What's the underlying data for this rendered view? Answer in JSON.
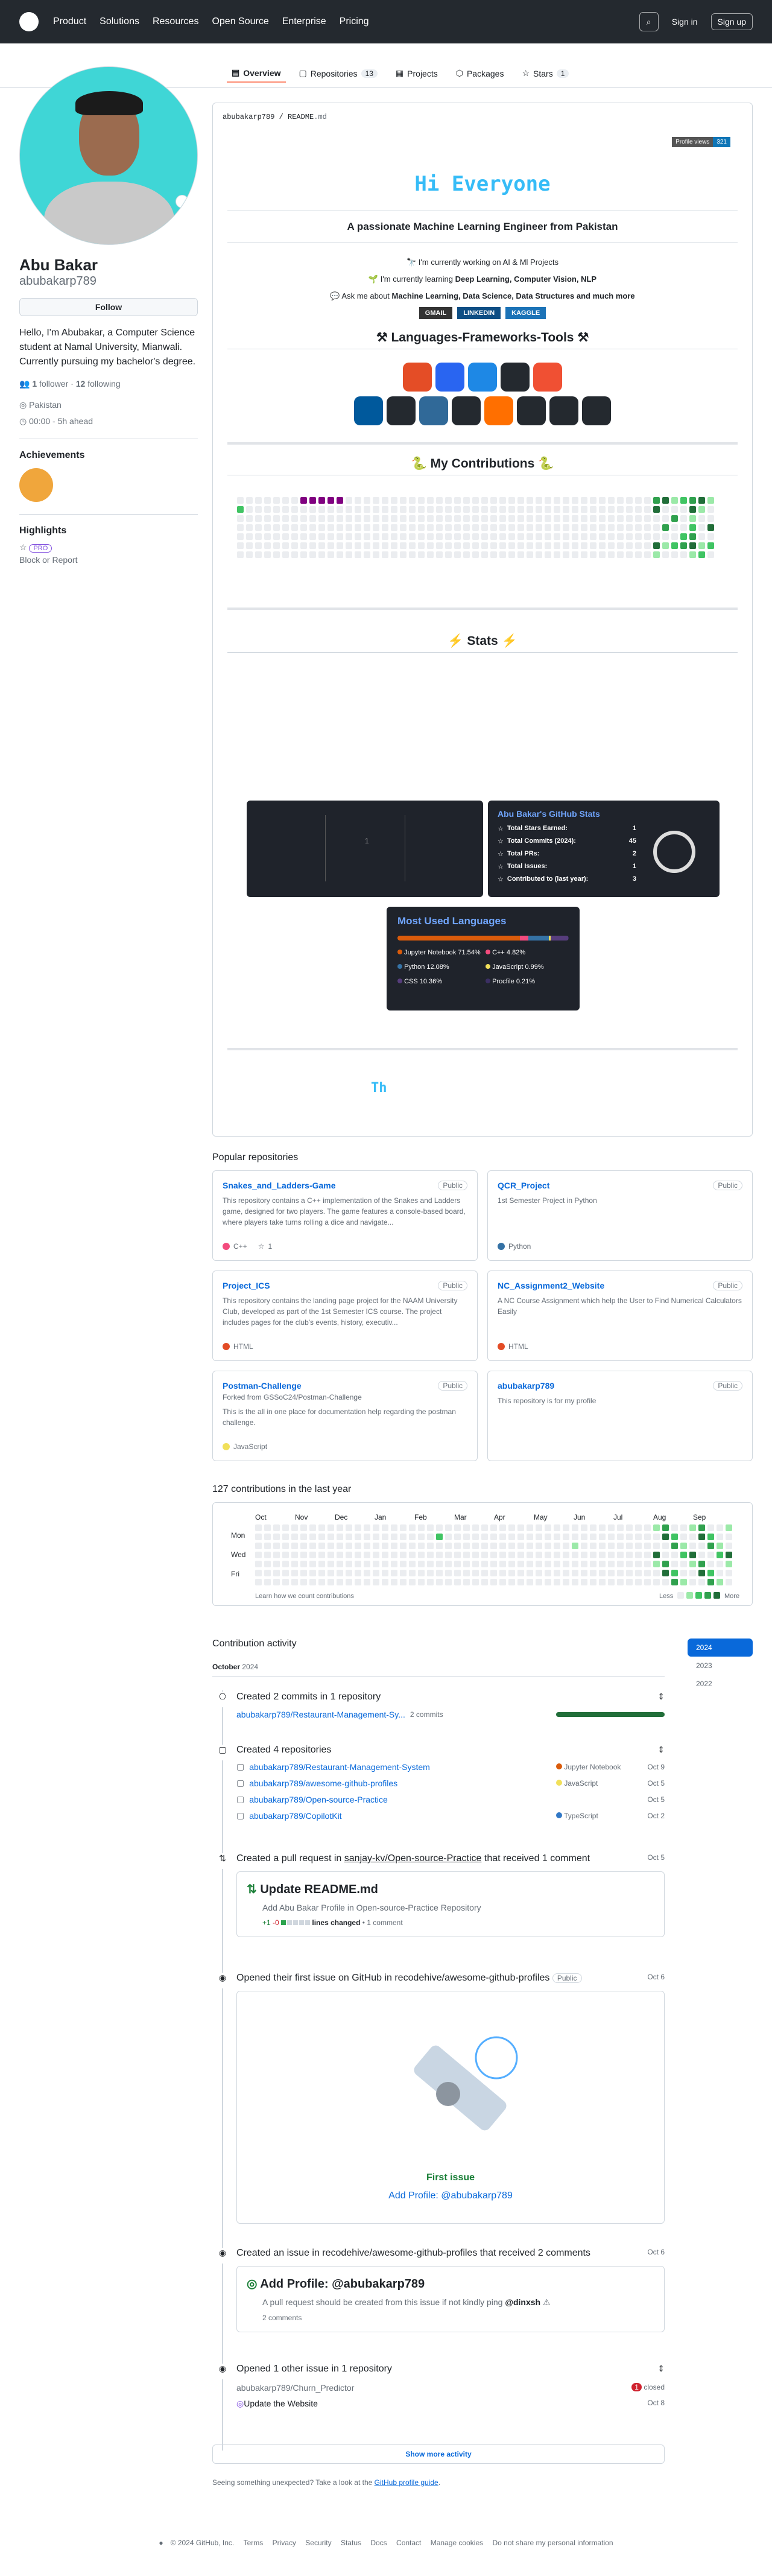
{
  "nav": {
    "items": [
      "Product",
      "Solutions",
      "Resources",
      "Open Source",
      "Enterprise",
      "Pricing"
    ],
    "signin": "Sign in",
    "signup": "Sign up"
  },
  "tabs": [
    {
      "label": "Overview"
    },
    {
      "label": "Repositories",
      "count": "13"
    },
    {
      "label": "Projects"
    },
    {
      "label": "Packages"
    },
    {
      "label": "Stars",
      "count": "1"
    }
  ],
  "profile": {
    "name": "Abu Bakar",
    "username": "abubakarp789",
    "follow": "Follow",
    "bio": "Hello, I'm Abubakar, a Computer Science student at Namal University, Mianwali. Currently pursuing my bachelor's degree.",
    "followers": "1",
    "followers_label": "follower",
    "following": "12",
    "following_label": "following",
    "location": "Pakistan",
    "time": "00:00",
    "time_ahead": "- 5h ahead",
    "achievements": "Achievements",
    "highlights": "Highlights",
    "pro": "PRO",
    "block": "Block or Report"
  },
  "readme": {
    "path_user": "abubakarp789",
    "path_file": "README",
    "path_ext": ".md",
    "views_label": "Profile views",
    "views": "321",
    "hi": "Hi Everyone",
    "tagline": "A passionate Machine Learning Engineer from Pakistan",
    "line1": "I'm currently working on AI & Ml Projects",
    "line2a": "I'm currently learning ",
    "line2b": "Deep Learning, Computer Vision, NLP",
    "line3a": "Ask me about ",
    "line3b": "Machine Learning, Data Science, Data Structures and much more",
    "badges": [
      "GMAIL",
      "LINKEDIN",
      "KAGGLE"
    ],
    "tools_title": "Languages-Frameworks-Tools",
    "contrib_title": "My Contributions",
    "stats_title": "Stats",
    "th": "Th",
    "stats": {
      "title": "Abu Bakar's GitHub Stats",
      "rows": [
        {
          "label": "Total Stars Earned:",
          "value": "1"
        },
        {
          "label": "Total Commits (2024):",
          "value": "45"
        },
        {
          "label": "Total PRs:",
          "value": "2"
        },
        {
          "label": "Total Issues:",
          "value": "1"
        },
        {
          "label": "Contributed to (last year):",
          "value": "3"
        }
      ],
      "left_num": "1"
    },
    "langs": {
      "title": "Most Used Languages",
      "items": [
        {
          "name": "Jupyter Notebook",
          "pct": "71.54%",
          "color": "#DA5B0B"
        },
        {
          "name": "C++",
          "pct": "4.82%",
          "color": "#f34b7d"
        },
        {
          "name": "Python",
          "pct": "12.08%",
          "color": "#3572A5"
        },
        {
          "name": "JavaScript",
          "pct": "0.99%",
          "color": "#f1e05a"
        },
        {
          "name": "CSS",
          "pct": "10.36%",
          "color": "#563d7c"
        },
        {
          "name": "Procfile",
          "pct": "0.21%",
          "color": "#3B2F63"
        }
      ]
    }
  },
  "popular_title": "Popular repositories",
  "repos": [
    {
      "name": "Snakes_and_Ladders-Game",
      "vis": "Public",
      "desc": "This repository contains a C++ implementation of the Snakes and Ladders game, designed for two players. The game features a console-based board, where players take turns rolling a dice and navigate...",
      "lang": "C++",
      "color": "#f34b7d",
      "stars": "1"
    },
    {
      "name": "QCR_Project",
      "vis": "Public",
      "desc": "1st Semester Project in Python",
      "lang": "Python",
      "color": "#3572A5",
      "stars": ""
    },
    {
      "name": "Project_ICS",
      "vis": "Public",
      "desc": "This repository contains the landing page project for the NAAM University Club, developed as part of the 1st Semester ICS course. The project includes pages for the club's events, history, executiv...",
      "lang": "HTML",
      "color": "#e34c26",
      "stars": ""
    },
    {
      "name": "NC_Assignment2_Website",
      "vis": "Public",
      "desc": "A NC Course Assignment which help the User to Find Numerical Calculators Easily",
      "lang": "HTML",
      "color": "#e34c26",
      "stars": ""
    },
    {
      "name": "Postman-Challenge",
      "vis": "Public",
      "forked": "Forked from GSSoC24/Postman-Challenge",
      "desc": "This is the all in one place for documentation help regarding the postman challenge.",
      "lang": "JavaScript",
      "color": "#f1e05a",
      "stars": ""
    },
    {
      "name": "abubakarp789",
      "vis": "Public",
      "desc": "This repository is for my profile",
      "lang": "",
      "color": "",
      "stars": ""
    }
  ],
  "contrib": {
    "title": "127 contributions in the last year",
    "months": [
      "Oct",
      "Nov",
      "Dec",
      "Jan",
      "Feb",
      "Mar",
      "Apr",
      "May",
      "Jun",
      "Jul",
      "Aug",
      "Sep"
    ],
    "days": [
      "Mon",
      "Wed",
      "Fri"
    ],
    "learn": "Learn how we count contributions",
    "less": "Less",
    "more": "More"
  },
  "activity": {
    "title": "Contribution activity",
    "month": "October",
    "year": "2024",
    "years": [
      "2024",
      "2023",
      "2022"
    ],
    "e1": {
      "title": "Created 2 commits in 1 repository",
      "repo": "abubakarp789/Restaurant-Management-Sy...",
      "commits": "2 commits"
    },
    "e2": {
      "title": "Created 4 repositories",
      "repos": [
        {
          "name": "abubakarp789/Restaurant-Management-System",
          "lang": "Jupyter Notebook",
          "color": "#DA5B0B",
          "date": "Oct 9"
        },
        {
          "name": "abubakarp789/awesome-github-profiles",
          "lang": "JavaScript",
          "color": "#f1e05a",
          "date": "Oct 5"
        },
        {
          "name": "abubakarp789/Open-source-Practice",
          "lang": "",
          "color": "",
          "date": "Oct 5"
        },
        {
          "name": "abubakarp789/CopilotKit",
          "lang": "TypeScript",
          "color": "#3178c6",
          "date": "Oct 2"
        }
      ]
    },
    "e3": {
      "title_a": "Created a pull request in ",
      "repo": "sanjay-kv/Open-source-Practice",
      "title_b": " that received 1 comment",
      "date": "Oct 5",
      "pr": "Update README.md",
      "body": "Add Abu Bakar Profile in Open-source-Practice Repository",
      "plus": "+1",
      "minus": "-0",
      "lines": "lines changed",
      "comments": "• 1 comment"
    },
    "e4": {
      "title": "Opened their first issue on GitHub in recodehive/awesome-github-profiles",
      "vis": "Public",
      "date": "Oct 6",
      "label": "First issue",
      "link": "Add Profile: @abubakarp789"
    },
    "e5": {
      "title": "Created an issue in recodehive/awesome-github-profiles that received 2 comments",
      "date": "Oct 6",
      "issue": "Add Profile: @abubakarp789",
      "body_a": "A pull request should be created from this issue if not kindly ping ",
      "body_b": "@dinxsh",
      "comments": "2 comments"
    },
    "e6": {
      "title": "Opened 1 other issue in 1 repository",
      "repo": "abubakarp789/Churn_Predictor",
      "closed": "closed",
      "issue": "Update the Website",
      "date": "Oct 8",
      "count": "1"
    },
    "more": "Show more activity",
    "unexpected": "Seeing something unexpected? Take a look at the ",
    "guide": "GitHub profile guide"
  },
  "footer": {
    "copy": "© 2024 GitHub, Inc.",
    "links": [
      "Terms",
      "Privacy",
      "Security",
      "Status",
      "Docs",
      "Contact",
      "Manage cookies",
      "Do not share my personal information"
    ]
  }
}
